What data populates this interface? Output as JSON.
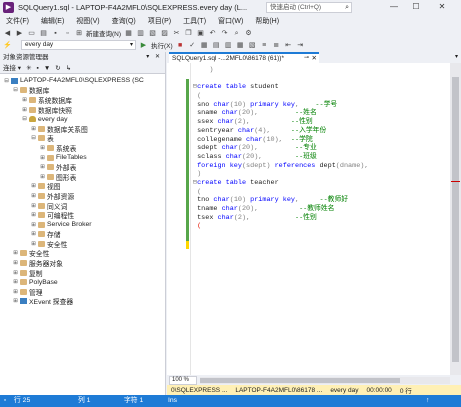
{
  "window": {
    "title": "SQLQuery1.sql - LAPTOP-F4A2MFL0\\SQLEXPRESS.every day (L...",
    "quick_launch_placeholder": "快速启动 (Ctrl+Q)",
    "minimize": "—",
    "maximize": "☐",
    "close": "✕"
  },
  "menu": [
    "文件(F)",
    "编辑(E)",
    "视图(V)",
    "查询(Q)",
    "项目(P)",
    "工具(T)",
    "窗口(W)",
    "帮助(H)"
  ],
  "toolbar": {
    "new_query": "新建查询(N)",
    "database": "every day",
    "execute": "执行(X)"
  },
  "object_explorer": {
    "title": "对象资源管理器",
    "header_controls": "▾ ✕",
    "tools": [
      "连接 ▾",
      "✳",
      "▪",
      "▼",
      "↻",
      "↳"
    ],
    "nodes": [
      {
        "level": 0,
        "exp": "⊟",
        "icon": "server",
        "label": "LAPTOP-F4A2MFL0\\SQLEXPRESS (SC"
      },
      {
        "level": 1,
        "exp": "⊟",
        "icon": "folder",
        "label": "数据库"
      },
      {
        "level": 2,
        "exp": "⊞",
        "icon": "folder",
        "label": "系统数据库"
      },
      {
        "level": 2,
        "exp": "⊞",
        "icon": "folder",
        "label": "数据库快照"
      },
      {
        "level": 2,
        "exp": "⊟",
        "icon": "db",
        "label": "every day"
      },
      {
        "level": 3,
        "exp": "⊞",
        "icon": "folder",
        "label": "数据库关系图"
      },
      {
        "level": 3,
        "exp": "⊟",
        "icon": "folder",
        "label": "表"
      },
      {
        "level": 4,
        "exp": "⊞",
        "icon": "folder",
        "label": "系统表"
      },
      {
        "level": 4,
        "exp": "⊞",
        "icon": "folder",
        "label": "FileTables"
      },
      {
        "level": 4,
        "exp": "⊞",
        "icon": "folder",
        "label": "外部表"
      },
      {
        "level": 4,
        "exp": "⊞",
        "icon": "folder",
        "label": "图形表"
      },
      {
        "level": 3,
        "exp": "⊞",
        "icon": "folder",
        "label": "视图"
      },
      {
        "level": 3,
        "exp": "⊞",
        "icon": "folder",
        "label": "外部资源"
      },
      {
        "level": 3,
        "exp": "⊞",
        "icon": "folder",
        "label": "同义词"
      },
      {
        "level": 3,
        "exp": "⊞",
        "icon": "folder",
        "label": "可编程性"
      },
      {
        "level": 3,
        "exp": "⊞",
        "icon": "folder",
        "label": "Service Broker"
      },
      {
        "level": 3,
        "exp": "⊞",
        "icon": "folder",
        "label": "存储"
      },
      {
        "level": 3,
        "exp": "⊞",
        "icon": "folder",
        "label": "安全性"
      },
      {
        "level": 1,
        "exp": "⊞",
        "icon": "folder",
        "label": "安全性"
      },
      {
        "level": 1,
        "exp": "⊞",
        "icon": "folder",
        "label": "服务器对象"
      },
      {
        "level": 1,
        "exp": "⊞",
        "icon": "folder",
        "label": "复制"
      },
      {
        "level": 1,
        "exp": "⊞",
        "icon": "folder",
        "label": "PolyBase"
      },
      {
        "level": 1,
        "exp": "⊞",
        "icon": "folder",
        "label": "管理"
      },
      {
        "level": 1,
        "exp": "⊞",
        "icon": "server",
        "label": "XEvent 探查器"
      }
    ]
  },
  "editor": {
    "tab_title": "SQLQuery1.sql -...2MFL0\\86178 (61))*",
    "tab_pin": "⊸",
    "tab_close": "✕",
    "code_lines": [
      [
        {
          "t": "    )",
          "c": "gr"
        }
      ],
      [
        {
          "t": "",
          "c": ""
        }
      ],
      [
        {
          "t": "⊟",
          "c": "gr"
        },
        {
          "t": "create table",
          "c": "kw"
        },
        {
          "t": " student",
          "c": ""
        }
      ],
      [
        {
          "t": " (",
          "c": "gr"
        }
      ],
      [
        {
          "t": " sno ",
          "c": ""
        },
        {
          "t": "char",
          "c": "kw"
        },
        {
          "t": "(10) ",
          "c": "gr"
        },
        {
          "t": "primary key",
          "c": "kw"
        },
        {
          "t": ",    ",
          "c": "gr"
        },
        {
          "t": "--学号",
          "c": "cmt"
        }
      ],
      [
        {
          "t": " sname ",
          "c": ""
        },
        {
          "t": "char",
          "c": "kw"
        },
        {
          "t": "(20),         ",
          "c": "gr"
        },
        {
          "t": "--姓名",
          "c": "cmt"
        }
      ],
      [
        {
          "t": " ssex ",
          "c": ""
        },
        {
          "t": "char",
          "c": "kw"
        },
        {
          "t": "(2),          ",
          "c": "gr"
        },
        {
          "t": "--性别",
          "c": "cmt"
        }
      ],
      [
        {
          "t": " sentryear ",
          "c": ""
        },
        {
          "t": "char",
          "c": "kw"
        },
        {
          "t": "(4),     ",
          "c": "gr"
        },
        {
          "t": "--入学年份",
          "c": "cmt"
        }
      ],
      [
        {
          "t": " collegename ",
          "c": ""
        },
        {
          "t": "char",
          "c": "kw"
        },
        {
          "t": "(10),  ",
          "c": "gr"
        },
        {
          "t": "--学院",
          "c": "cmt"
        }
      ],
      [
        {
          "t": " sdept ",
          "c": ""
        },
        {
          "t": "char",
          "c": "kw"
        },
        {
          "t": "(20),         ",
          "c": "gr"
        },
        {
          "t": "--专业",
          "c": "cmt"
        }
      ],
      [
        {
          "t": " sclass ",
          "c": ""
        },
        {
          "t": "char",
          "c": "kw"
        },
        {
          "t": "(20),        ",
          "c": "gr"
        },
        {
          "t": "--班级",
          "c": "cmt"
        }
      ],
      [
        {
          "t": " foreign key",
          "c": "kw"
        },
        {
          "t": "(sdept) ",
          "c": "gr"
        },
        {
          "t": "references",
          "c": "kw"
        },
        {
          "t": " dept",
          "c": ""
        },
        {
          "t": "(dname),",
          "c": "gr"
        }
      ],
      [
        {
          "t": " )",
          "c": "gr"
        }
      ],
      [
        {
          "t": "⊟",
          "c": "gr"
        },
        {
          "t": "create table",
          "c": "kw"
        },
        {
          "t": " teacher",
          "c": ""
        }
      ],
      [
        {
          "t": " (",
          "c": "gr"
        }
      ],
      [
        {
          "t": " tno ",
          "c": ""
        },
        {
          "t": "char",
          "c": "kw"
        },
        {
          "t": "(10) ",
          "c": "gr"
        },
        {
          "t": "primary key",
          "c": "kw"
        },
        {
          "t": ",     ",
          "c": "gr"
        },
        {
          "t": "--教师好",
          "c": "cmt"
        }
      ],
      [
        {
          "t": " tname ",
          "c": ""
        },
        {
          "t": "char",
          "c": "kw"
        },
        {
          "t": "(20),          ",
          "c": "gr"
        },
        {
          "t": "--教师姓名",
          "c": "cmt"
        }
      ],
      [
        {
          "t": " tsex ",
          "c": ""
        },
        {
          "t": "char",
          "c": "kw"
        },
        {
          "t": "(2),           ",
          "c": "gr"
        },
        {
          "t": "--性别",
          "c": "cmt"
        }
      ],
      [
        {
          "t": " (",
          "c": "cursor"
        }
      ]
    ],
    "zoom": "100 %"
  },
  "query_status": [
    "0\\SQLEXPRESS ...",
    "LAPTOP-F4A2MFL0\\86178 ...",
    "every day",
    "00:00:00",
    "0 行"
  ],
  "status_bar": {
    "ready": "行 25",
    "col": "列 1",
    "char": "字符 1",
    "ins": "Ins"
  },
  "colors": {
    "accent": "#1e7bd6",
    "keyword": "#0000ff",
    "comment": "#008000",
    "query_status_bg": "#fff0b5"
  }
}
